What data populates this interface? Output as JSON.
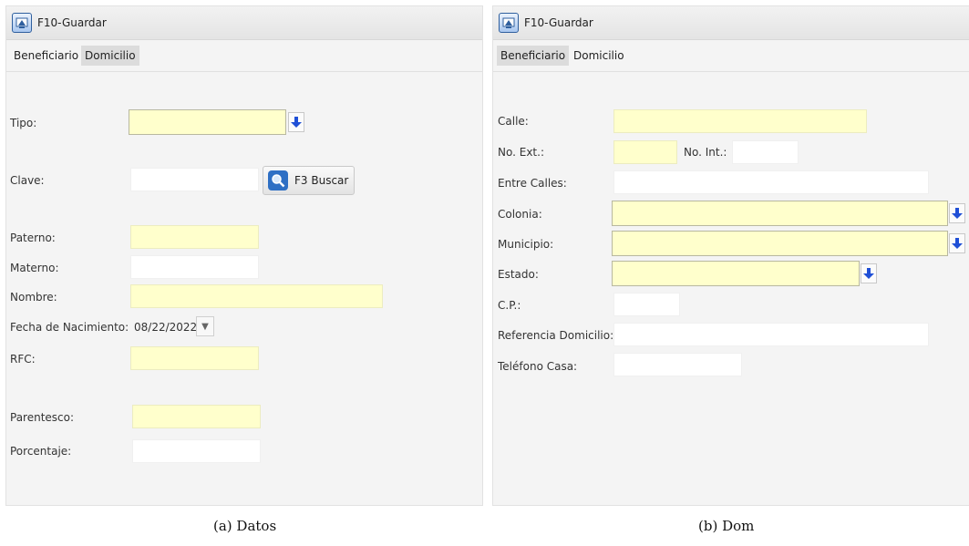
{
  "panel_a": {
    "toolbar": {
      "save_label": "F10-Guardar"
    },
    "tabs": [
      {
        "label": "Beneficiario"
      },
      {
        "label": "Domicilio"
      }
    ],
    "form": {
      "tipo_label": "Tipo:",
      "clave_label": "Clave:",
      "search_label": "F3 Buscar",
      "paterno_label": "Paterno:",
      "materno_label": "Materno:",
      "nombre_label": "Nombre:",
      "fecha_label": "Fecha de Nacimiento:",
      "fecha_value": "08/22/2022",
      "rfc_label": "RFC:",
      "parentesco_label": "Parentesco:",
      "porcentaje_label": "Porcentaje:"
    },
    "caption": "(a)  Datos"
  },
  "panel_b": {
    "toolbar": {
      "save_label": "F10-Guardar"
    },
    "tabs": [
      {
        "label": "Beneficiario"
      },
      {
        "label": "Domicilio"
      }
    ],
    "form": {
      "calle_label": "Calle:",
      "no_ext_label": "No. Ext.:",
      "no_int_label": "No. Int.:",
      "entre_calles_label": "Entre Calles:",
      "colonia_label": "Colonia:",
      "municipio_label": "Municipio:",
      "estado_label": "Estado:",
      "cp_label": "C.P.:",
      "referencia_label": "Referencia Domicilio:",
      "telefono_label": "Teléfono Casa:"
    },
    "caption": "(b)  Dom"
  },
  "colors": {
    "required_field": "#ffffcc",
    "panel_bg": "#f4f4f4",
    "dropdown_arrow": "#1f4fd6"
  },
  "icons": {
    "save": "save-window-icon",
    "search": "magnifier-icon",
    "dropdown": "blue-down-arrow-icon",
    "date": "triangle-down-icon"
  }
}
